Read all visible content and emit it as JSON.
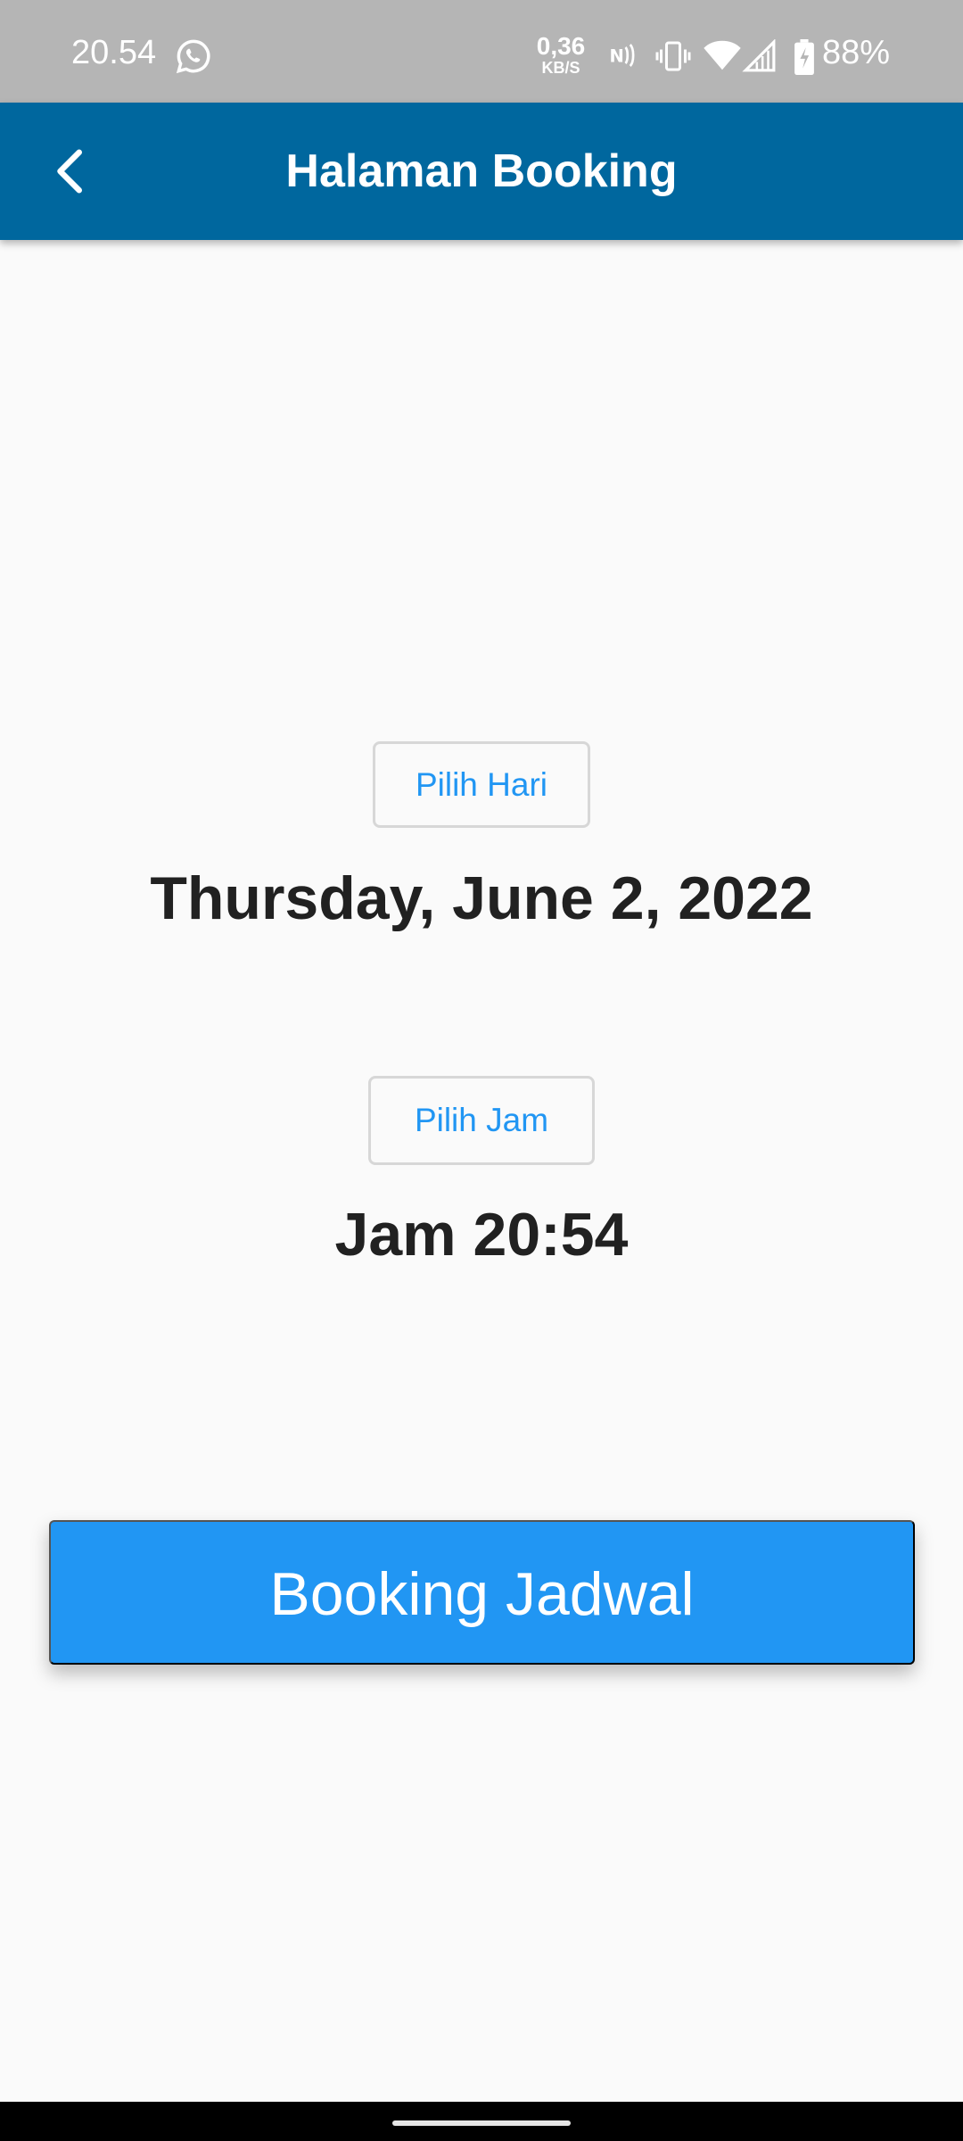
{
  "status_bar": {
    "time": "20.54",
    "net_speed_value": "0,36",
    "net_speed_unit": "KB/S",
    "battery_percent": "88%",
    "icons": [
      "whatsapp-icon",
      "nfc-icon",
      "vibrate-icon",
      "wifi-icon",
      "signal-icon",
      "battery-charging-icon"
    ]
  },
  "app_bar": {
    "title": "Halaman Booking",
    "back_icon": "chevron-left-icon",
    "background": "#00679e"
  },
  "main": {
    "pick_day_label": "Pilih Hari",
    "selected_date": "Thursday, June 2, 2022",
    "pick_time_label": "Pilih Jam",
    "selected_time": "Jam 20:54",
    "submit_label": "Booking Jadwal",
    "accent": "#2196f3"
  }
}
